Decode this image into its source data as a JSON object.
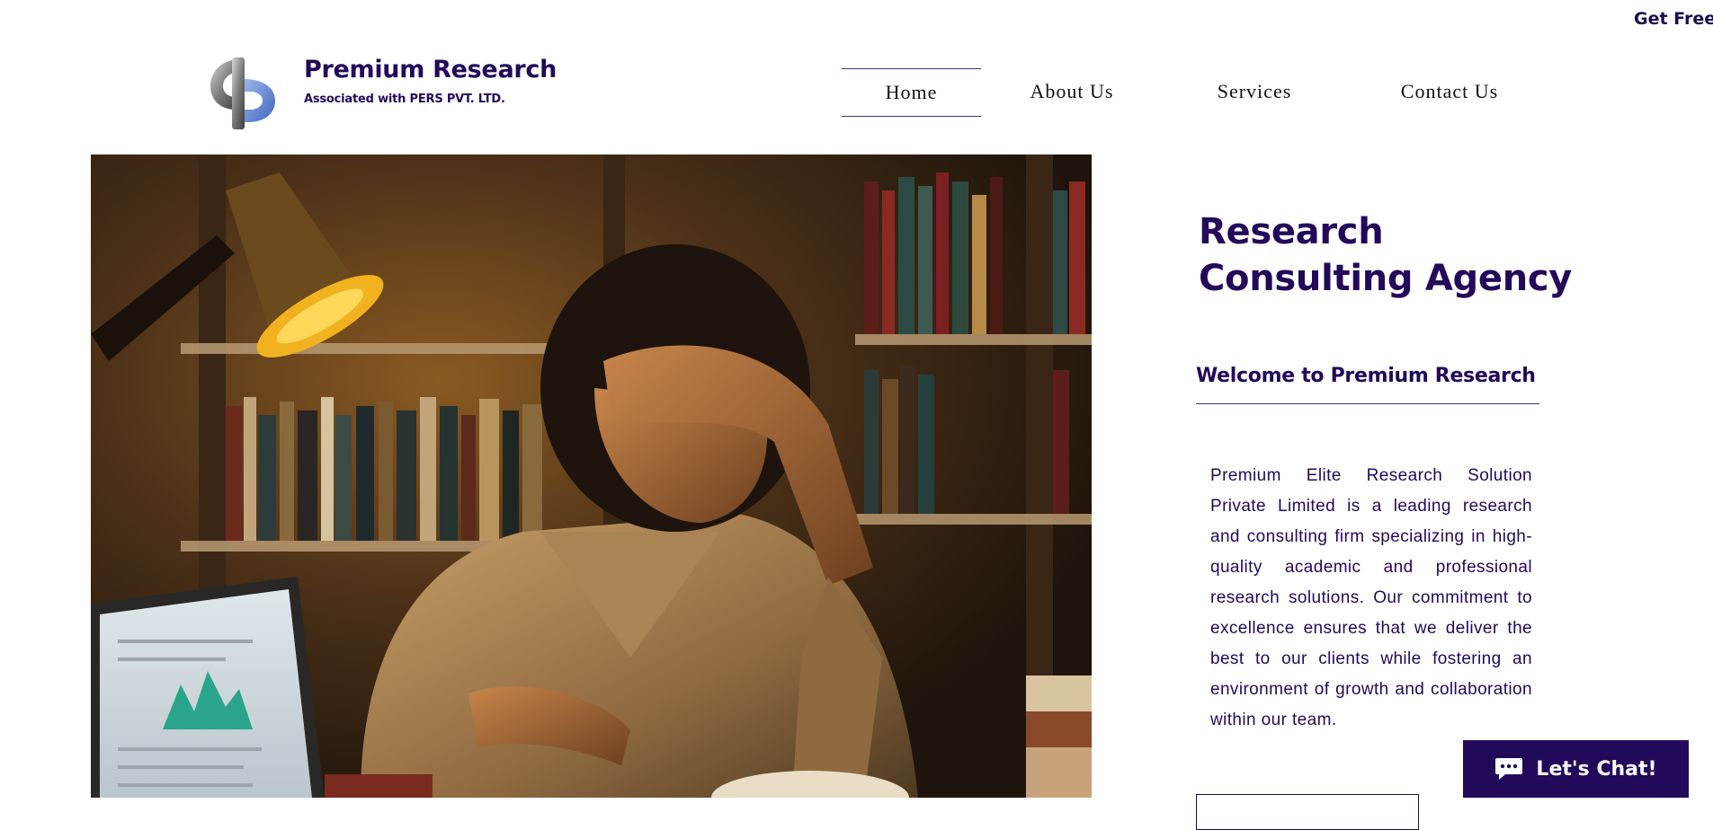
{
  "header": {
    "top_cta": "Get Free C",
    "brand": {
      "title": "Premium Research",
      "subtitle": "Associated with PERS PVT. LTD."
    },
    "nav": [
      {
        "label": "Home",
        "active": true
      },
      {
        "label": "About Us",
        "active": false
      },
      {
        "label": "Services",
        "active": false
      },
      {
        "label": "Contact Us",
        "active": false
      }
    ]
  },
  "hero": {
    "image_description_icon": "man-studying-at-desk-image",
    "headline_line1": "Research",
    "headline_line2": "Consulting Agency",
    "welcome": "Welcome to Premium Research",
    "intro": "Premium Elite Research Solution Private Limited is a leading research and consulting firm specializing in high-quality academic and professional research solutions. Our commitment to excellence ensures that we deliver the best to our clients while fostering an environment of growth and collaboration within our team."
  },
  "chat": {
    "label": "Let's Chat!",
    "icon": "chat-bubble-icon"
  },
  "colors": {
    "brand_purple": "#23095a",
    "accent_blue": "#4a76c9"
  }
}
